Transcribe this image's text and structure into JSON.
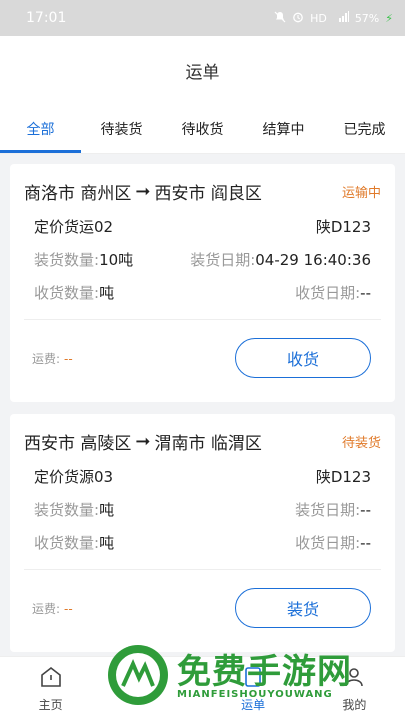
{
  "status_bar": {
    "time": "17:01",
    "network": "HD",
    "signal": "4G",
    "battery": "57%"
  },
  "header": {
    "title": "运单"
  },
  "tabs": [
    {
      "label": "全部",
      "active": true
    },
    {
      "label": "待装货",
      "active": false
    },
    {
      "label": "待收货",
      "active": false
    },
    {
      "label": "结算中",
      "active": false
    },
    {
      "label": "已完成",
      "active": false
    }
  ],
  "orders": [
    {
      "from": "商洛市 商州区",
      "to": "西安市 阎良区",
      "status": "运输中",
      "goods_name": "定价货运02",
      "plate": "陕D123",
      "load_qty_label": "装货数量:",
      "load_qty_value": "10吨",
      "load_date_label": "装货日期:",
      "load_date_value": "04-29 16:40:36",
      "recv_qty_label": "收货数量:",
      "recv_qty_value": "吨",
      "recv_date_label": "收货日期:",
      "recv_date_value": "--",
      "fee_label": "运费:",
      "fee_value": "--",
      "action": "收货"
    },
    {
      "from": "西安市 高陵区",
      "to": "渭南市 临渭区",
      "status": "待装货",
      "goods_name": "定价货源03",
      "plate": "陕D123",
      "load_qty_label": "装货数量:",
      "load_qty_value": "吨",
      "load_date_label": "装货日期:",
      "load_date_value": "--",
      "recv_qty_label": "收货数量:",
      "recv_qty_value": "吨",
      "recv_date_label": "收货日期:",
      "recv_date_value": "--",
      "fee_label": "运费:",
      "fee_value": "--",
      "action": "装货"
    }
  ],
  "bottom_nav": [
    {
      "label": "主页",
      "icon": "home-icon"
    },
    {
      "label": "",
      "icon": "blank"
    },
    {
      "label": "运单",
      "icon": "order-icon"
    },
    {
      "label": "我的",
      "icon": "user-icon"
    }
  ],
  "watermark": {
    "main": "免费手游网",
    "sub": "MIANFEISHOUYOUWANG"
  },
  "colors": {
    "accent": "#1b6fd8",
    "status_orange": "#e07a2a",
    "watermark_green": "#2f9c3a"
  }
}
